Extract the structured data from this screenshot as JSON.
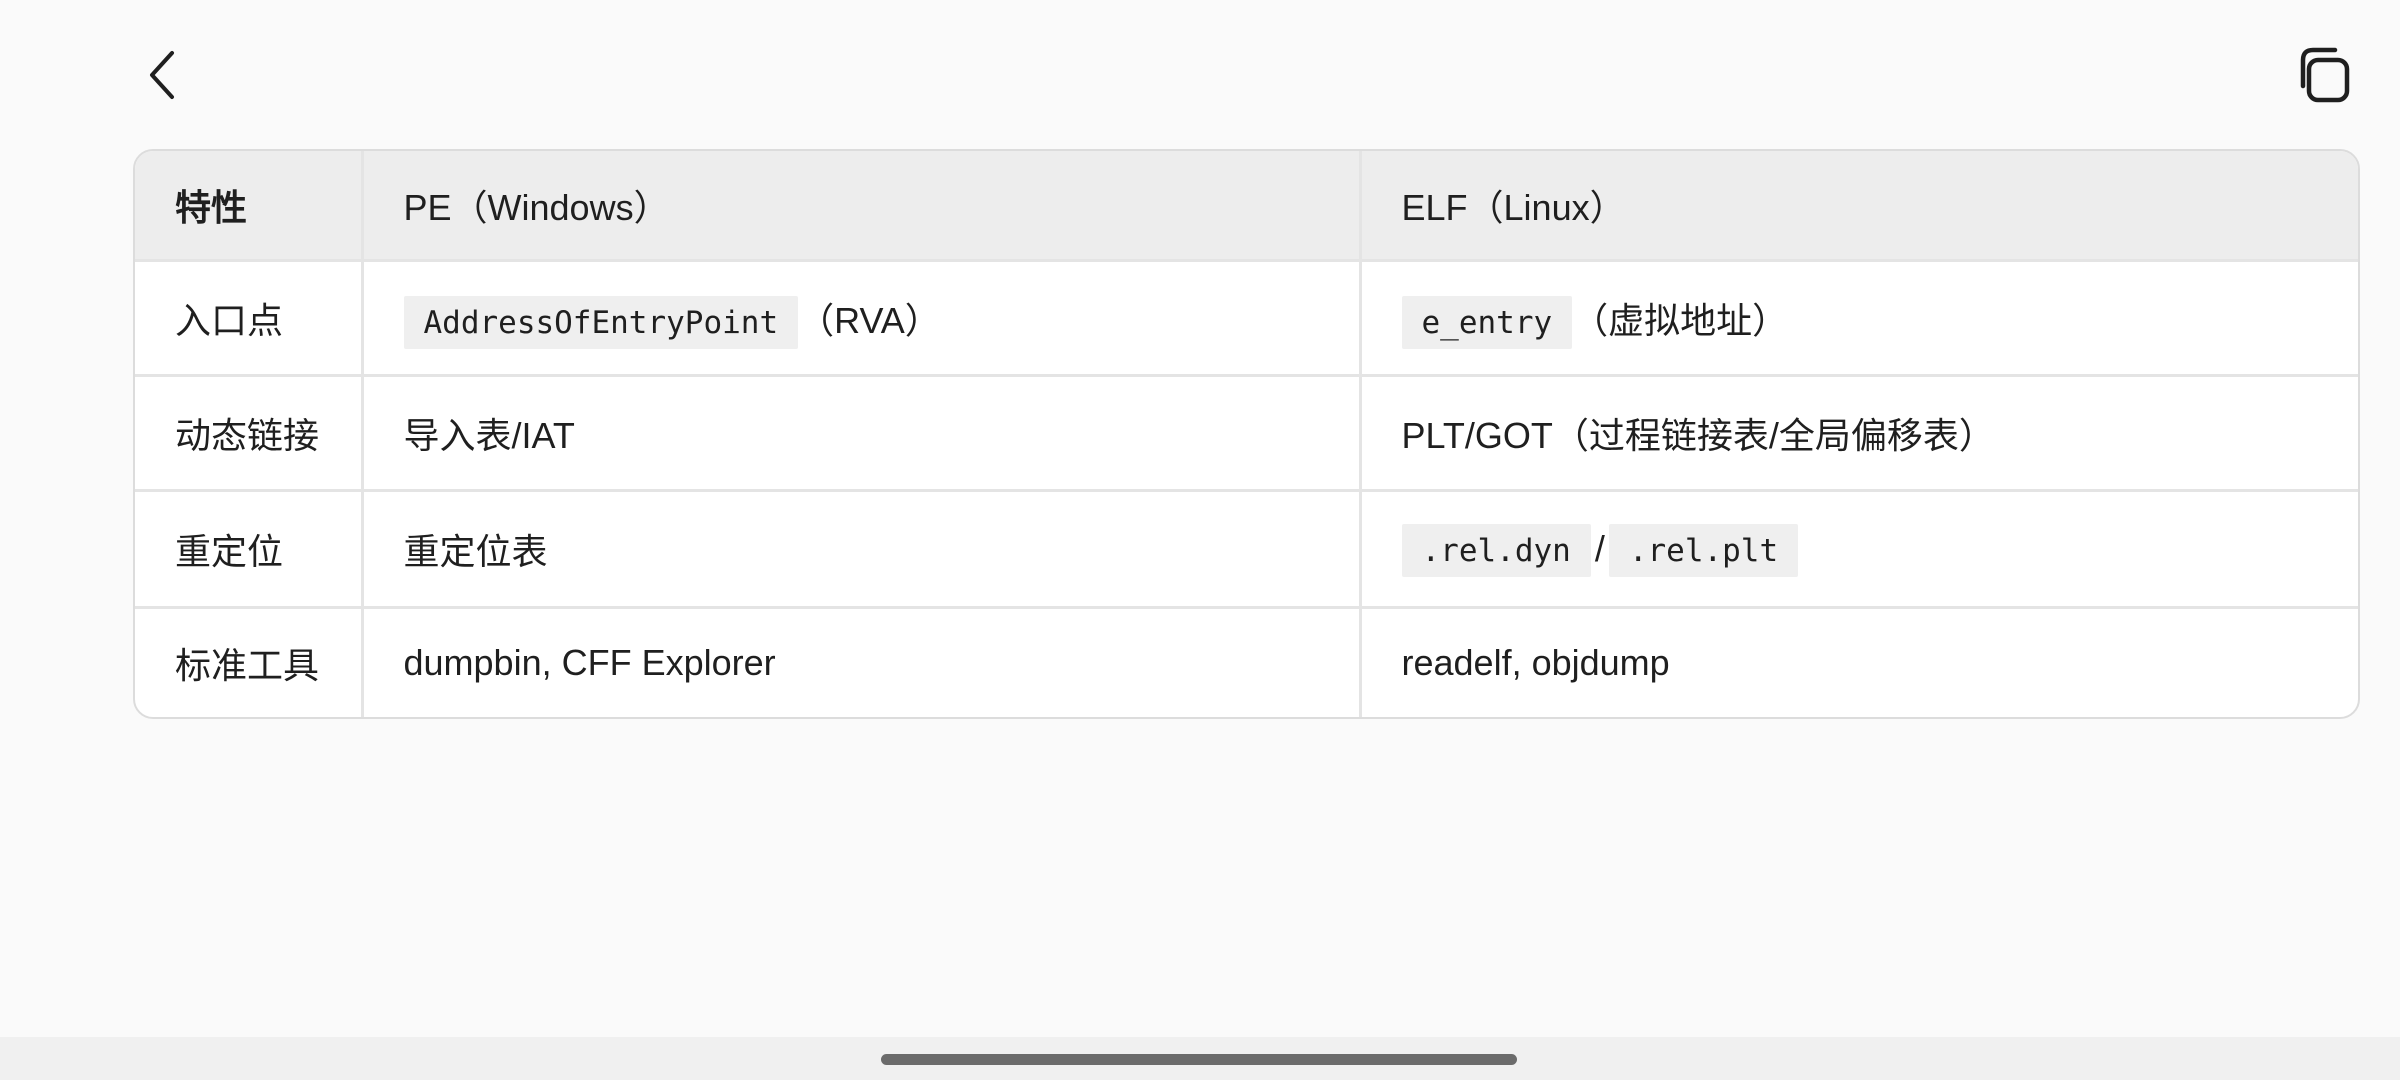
{
  "topbar": {
    "back_icon": "chevron-left-icon",
    "copy_icon": "copy-icon"
  },
  "table": {
    "headers": [
      "特性",
      "PE（Windows）",
      "ELF（Linux）"
    ],
    "rows": [
      {
        "feature": "入口点",
        "pe": {
          "code": "AddressOfEntryPoint",
          "text": "（RVA）"
        },
        "elf": {
          "code": "e_entry",
          "text": "（虚拟地址）"
        }
      },
      {
        "feature": "动态链接",
        "pe": {
          "text": "导入表/IAT"
        },
        "elf": {
          "text": "PLT/GOT（过程链接表/全局偏移表）"
        }
      },
      {
        "feature": "重定位",
        "pe": {
          "text": "重定位表"
        },
        "elf": {
          "code1": ".rel.dyn",
          "sep": "/",
          "code2": ".rel.plt"
        }
      },
      {
        "feature": "标准工具",
        "pe": {
          "text": "dumpbin, CFF Explorer"
        },
        "elf": {
          "text": "readelf, objdump"
        }
      }
    ]
  },
  "colors": {
    "page_bg": "#fafafa",
    "header_bg": "#ededed",
    "code_bg": "#efefef",
    "border": "#e4e4e4",
    "home_indicator": "#6b6b6b"
  }
}
